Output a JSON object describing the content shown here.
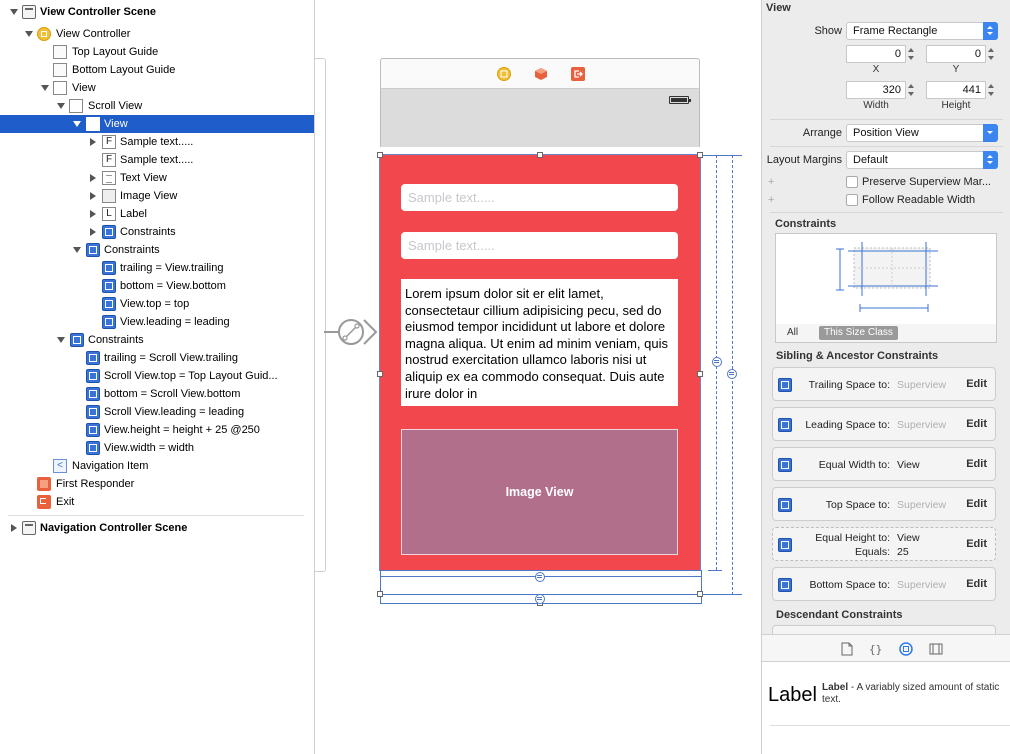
{
  "outline": {
    "items": [
      {
        "label": "View Controller Scene",
        "icon": "scene-icon",
        "bold": true
      },
      {
        "label": "View Controller",
        "icon": "view-controller-icon"
      },
      {
        "label": "Top Layout Guide",
        "icon": "layout-guide-icon"
      },
      {
        "label": "Bottom Layout Guide",
        "icon": "layout-guide-icon"
      },
      {
        "label": "View",
        "icon": "view-icon"
      },
      {
        "label": "Scroll View",
        "icon": "view-icon"
      },
      {
        "label": "View",
        "icon": "view-icon",
        "selected": true
      },
      {
        "label": "Sample text.....",
        "icon": "textfield-icon",
        "glyph": "F"
      },
      {
        "label": "Sample text.....",
        "icon": "textfield-icon",
        "glyph": "F"
      },
      {
        "label": "Text View",
        "icon": "textview-icon"
      },
      {
        "label": "Image View",
        "icon": "imageview-icon"
      },
      {
        "label": "Label",
        "icon": "label-icon",
        "glyph": "L"
      },
      {
        "label": "Constraints",
        "icon": "constraints-icon"
      },
      {
        "label": "Constraints",
        "icon": "constraints-icon"
      },
      {
        "label": "trailing = View.trailing",
        "icon": "constraint-icon"
      },
      {
        "label": "bottom = View.bottom",
        "icon": "constraint-icon"
      },
      {
        "label": "View.top = top",
        "icon": "constraint-icon"
      },
      {
        "label": "View.leading = leading",
        "icon": "constraint-icon"
      },
      {
        "label": "Constraints",
        "icon": "constraints-icon"
      },
      {
        "label": "trailing = Scroll View.trailing",
        "icon": "constraint-icon"
      },
      {
        "label": "Scroll View.top = Top Layout Guid...",
        "icon": "constraint-icon"
      },
      {
        "label": "bottom = Scroll View.bottom",
        "icon": "constraint-icon"
      },
      {
        "label": "Scroll View.leading = leading",
        "icon": "constraint-icon"
      },
      {
        "label": "View.height = height + 25 @250",
        "icon": "constraint-icon"
      },
      {
        "label": "View.width = width",
        "icon": "constraint-icon"
      },
      {
        "label": "Navigation Item",
        "icon": "navigation-item-icon",
        "glyph": "<"
      },
      {
        "label": "First Responder",
        "icon": "first-responder-icon"
      },
      {
        "label": "Exit",
        "icon": "exit-icon"
      },
      {
        "label": "Navigation Controller Scene",
        "icon": "scene-icon",
        "bold": true
      }
    ]
  },
  "canvas": {
    "textfield1_placeholder": "Sample text.....",
    "textfield2_placeholder": "Sample text.....",
    "textview_text": "Lorem ipsum dolor sit er elit lamet, consectetaur cillium adipisicing pecu, sed do eiusmod tempor incididunt ut labore et dolore magna aliqua. Ut enim ad minim veniam, quis nostrud exercitation ullamco laboris nisi ut aliquip ex ea commodo consequat. Duis aute irure dolor in",
    "imageview_label": "Image View",
    "colors": {
      "view_bg": "#f2474c",
      "image_bg": "#b26f8b",
      "selection": "#1f5dcb"
    }
  },
  "inspector": {
    "section_view": "View",
    "show_label": "Show",
    "show_value": "Frame Rectangle",
    "x_value": "0",
    "y_value": "0",
    "x_label": "X",
    "y_label": "Y",
    "width_value": "320",
    "height_value": "441",
    "width_label": "Width",
    "height_label": "Height",
    "arrange_label": "Arrange",
    "arrange_value": "Position View",
    "margins_label": "Layout Margins",
    "margins_value": "Default",
    "preserve_label": "Preserve Superview Mar...",
    "readable_label": "Follow Readable Width",
    "constraints_header": "Constraints",
    "tab_all": "All",
    "tab_size_class": "This Size Class",
    "sibling_header": "Sibling & Ancestor Constraints",
    "cards": [
      {
        "text": "Trailing Space to:",
        "value": "Superview",
        "dim": true,
        "edit": "Edit"
      },
      {
        "text": "Leading Space to:",
        "value": "Superview",
        "dim": true,
        "edit": "Edit"
      },
      {
        "text": "Equal Width to:",
        "value": "View",
        "dim": false,
        "edit": "Edit"
      },
      {
        "text": "Top Space to:",
        "value": "Superview",
        "dim": true,
        "edit": "Edit"
      },
      {
        "text": "Equal Height to:",
        "value": "View",
        "dim": false,
        "edit": "Edit",
        "extra_label": "Equals:",
        "extra_value": "25"
      },
      {
        "text": "Bottom Space to:",
        "value": "Superview",
        "dim": true,
        "edit": "Edit"
      }
    ],
    "descendant_header": "Descendant Constraints",
    "library_title": "Label",
    "library_big": "Label",
    "library_desc": " - A variably sized amount of static text."
  }
}
